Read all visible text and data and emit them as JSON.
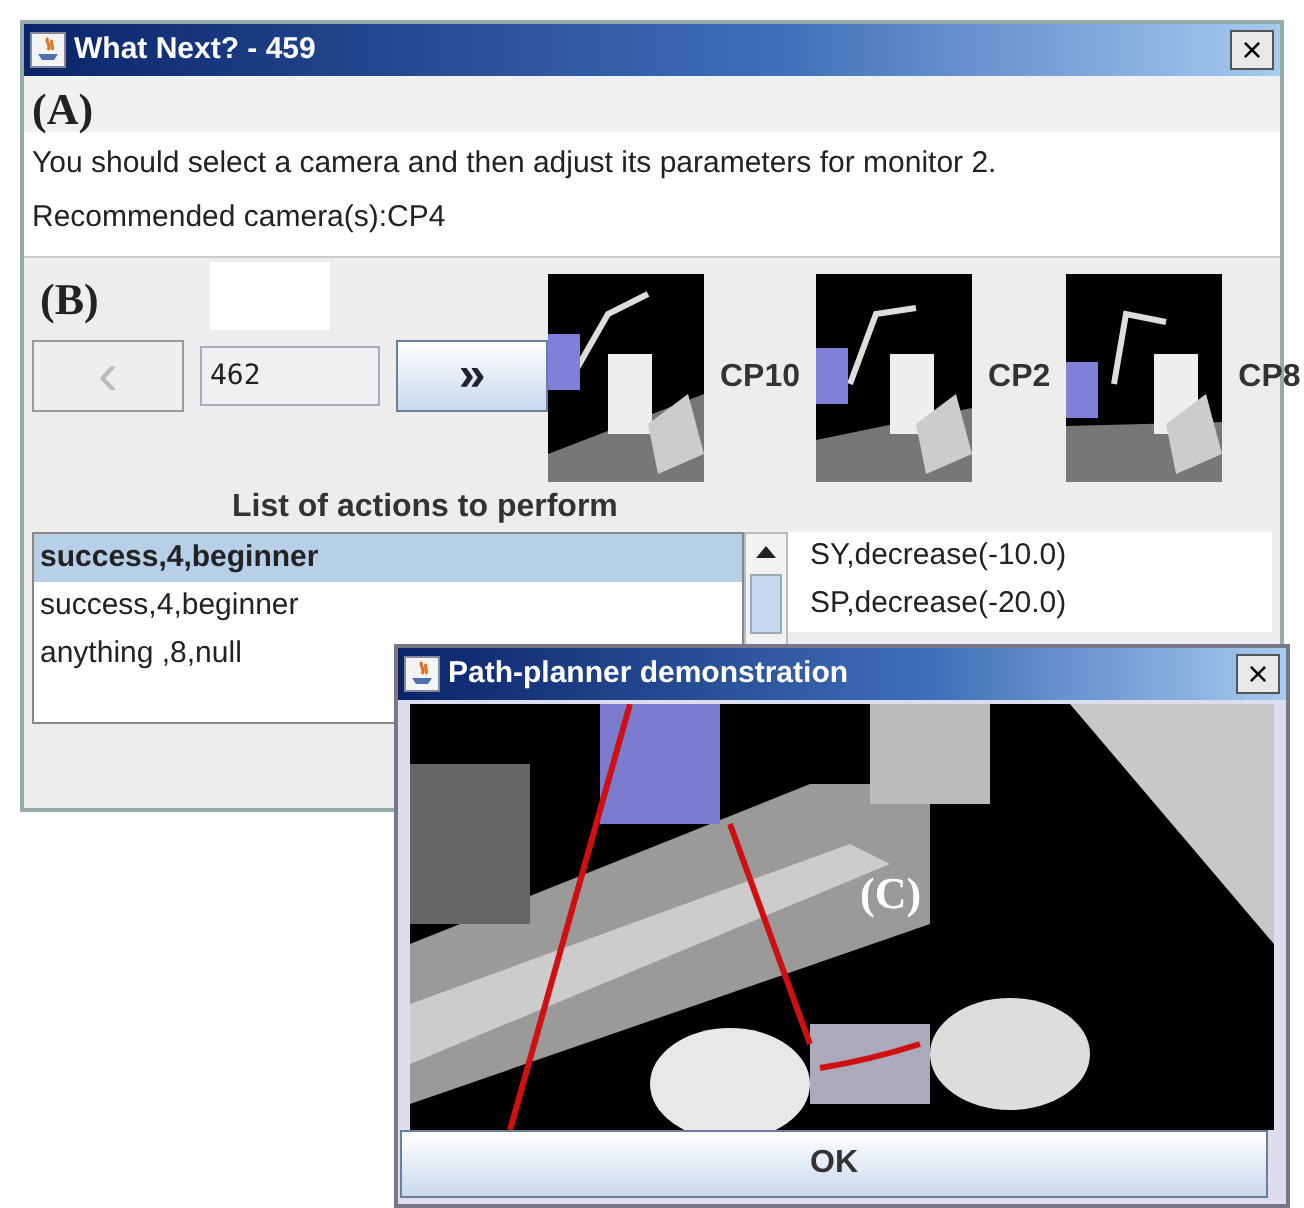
{
  "window": {
    "title": "What Next?  -  459",
    "close": "×"
  },
  "section_a": {
    "label": "(A)",
    "message": "You should select a camera and then adjust its parameters for monitor 2.",
    "recommendation": "Recommended camera(s):CP4"
  },
  "section_b": {
    "label": "(B)",
    "prev": "‹",
    "frame": "462",
    "next": "»",
    "cameras": [
      {
        "label": "CP10",
        "kind": "picture"
      },
      {
        "label": "CP2",
        "kind": "picture"
      },
      {
        "label": "CP8",
        "kind": "picture"
      }
    ]
  },
  "actions": {
    "title": "List of actions to perform",
    "items": [
      {
        "text": "success,4,beginner",
        "selected": true
      },
      {
        "text": "success,4,beginner",
        "selected": false
      },
      {
        "text": "anything ,8,null",
        "selected": false
      }
    ],
    "details": [
      "SY,decrease(-10.0)",
      "SP,decrease(-20.0)"
    ]
  },
  "dialog": {
    "title": "Path-planner demonstration",
    "close": "×",
    "annotation": "(C)",
    "button": "OK",
    "kind": "picture"
  }
}
